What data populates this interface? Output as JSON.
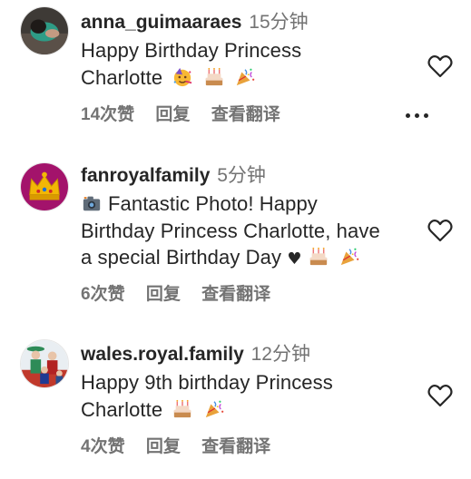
{
  "comments": [
    {
      "username": "anna_guimaaraes",
      "time": "15分钟",
      "text_lines": [
        "Happy Birthday Princess",
        "Charlotte"
      ],
      "emojis": [
        "partying-face-emoji",
        "birthday-cake-emoji",
        "party-popper-emoji"
      ],
      "likes": "14次赞",
      "reply": "回复",
      "translate": "查看翻译",
      "has_more_menu": true
    },
    {
      "username": "fanroyalfamily",
      "time": "5分钟",
      "text_lines": [
        "Fantastic Photo! Happy",
        "Birthday Princess Charlotte, have",
        "a special Birthday Day"
      ],
      "heart": "♥",
      "emojis": [
        "camera-emoji",
        "birthday-cake-emoji",
        "party-popper-emoji"
      ],
      "likes": "6次赞",
      "reply": "回复",
      "translate": "查看翻译"
    },
    {
      "username": "wales.royal.family",
      "time": "12分钟",
      "text_lines": [
        "Happy 9th birthday Princess",
        "Charlotte"
      ],
      "emojis": [
        "birthday-cake-emoji",
        "party-popper-emoji"
      ],
      "likes": "4次赞",
      "reply": "回复",
      "translate": "查看翻译"
    }
  ],
  "colors": {
    "text": "#262626",
    "secondary": "#737373",
    "crown_bg": "#a3136b",
    "crown_gold": "#f2b705"
  },
  "icons": [
    "heart-outline-icon",
    "more-horizontal-icon"
  ]
}
